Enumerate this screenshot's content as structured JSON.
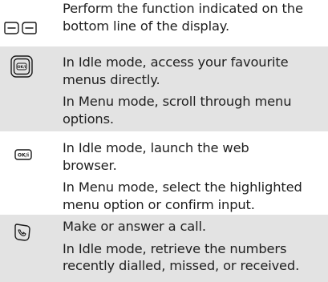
{
  "rows": [
    {
      "icon": "soft-keys-icon",
      "lines": [
        [
          "Perform the function indicated on the",
          "bottom line of the display."
        ]
      ]
    },
    {
      "icon": "nav-ok-key-icon",
      "key_label": "OK/i",
      "lines": [
        [
          "In Idle mode, access your favourite",
          "menus directly."
        ],
        [
          "In Menu mode, scroll through menu",
          "options."
        ]
      ]
    },
    {
      "icon": "ok-key-icon",
      "key_label": "OK/i",
      "lines": [
        [
          "In Idle mode, launch the web",
          "browser."
        ],
        [
          "In Menu mode, select the highlighted",
          "menu option or confirm input."
        ]
      ]
    },
    {
      "icon": "dial-key-icon",
      "lines": [
        [
          "Make or answer a call."
        ],
        [
          "In Idle mode, retrieve the numbers",
          "recently dialled, missed, or received."
        ]
      ]
    }
  ]
}
